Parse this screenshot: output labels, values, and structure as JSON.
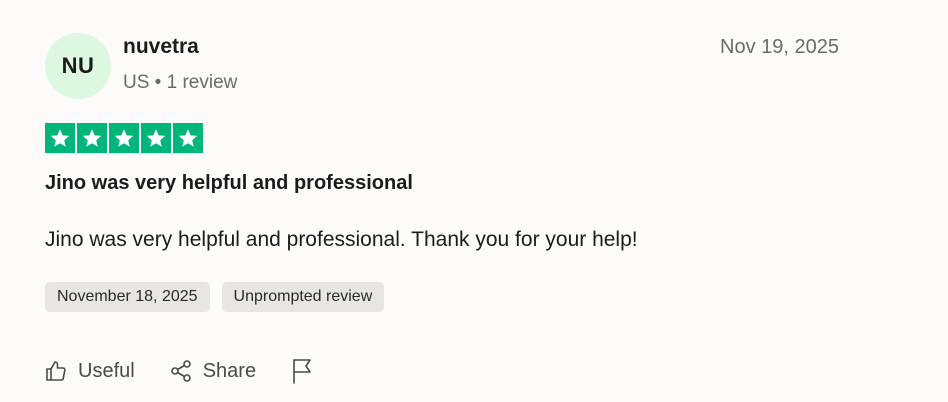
{
  "reviewer": {
    "initials": "NU",
    "name": "nuvetra",
    "meta": "US • 1 review"
  },
  "review": {
    "posted_date": "Nov 19, 2025",
    "rating": 5,
    "rating_max": 5,
    "star_color": "#00b67a",
    "title": "Jino was very helpful and professional",
    "text": "Jino was very helpful and professional. Thank you for your help!",
    "tags": [
      {
        "label": "November 18, 2025"
      },
      {
        "label": "Unprompted review"
      }
    ]
  },
  "actions": {
    "useful_label": "Useful",
    "useful_icon": "thumbs-up-icon",
    "share_label": "Share",
    "share_icon": "share-icon",
    "report_icon": "flag-icon"
  },
  "colors": {
    "avatar_bg": "#dcf8e0",
    "background": "#fcfbf9",
    "tag_bg": "#e8e6e3"
  }
}
